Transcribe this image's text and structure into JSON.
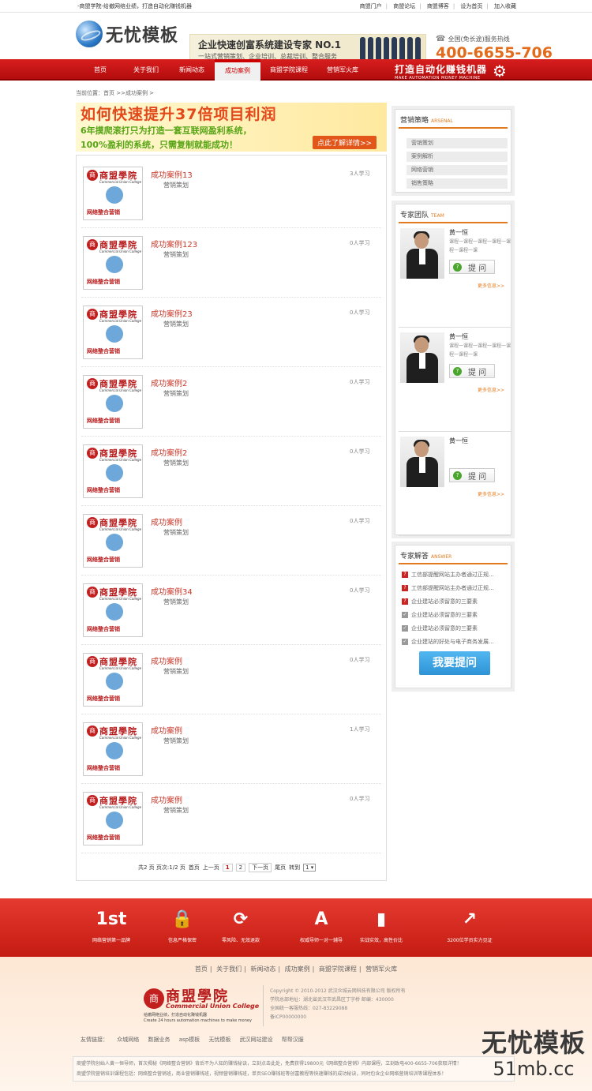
{
  "topbar": {
    "slogan": "-商盟学院-给撤网络业绩，打造自动化赚钱机器",
    "links": [
      "商盟门户",
      "商盟论坛",
      "商盟博客",
      "设为首页",
      "加入收藏"
    ]
  },
  "header": {
    "logo_text": "无忧模板",
    "banner_title": "企业快速创富系统建设专家 NO.1",
    "banner_sub": "一站式营销策划、企业培训、总裁培训、整合服务",
    "hotline_label": "全国(免长途)服务热线",
    "hotline_number": "400-6655-706"
  },
  "nav": {
    "items": [
      "首页",
      "关于我们",
      "新闻动态",
      "成功案例",
      "商盟学院课程",
      "营销军火库"
    ],
    "active_index": 3,
    "slogan": "打造自动化赚钱机器",
    "slogan_en": "MAKE AUTOMATION MONEY MACHINE"
  },
  "breadcrumb": "当前位置：首页 >>成功案例 >",
  "promo": {
    "line1": "如何快速提升37倍项目利润",
    "line2": "6年摸爬滚打只为打造一套互联网盈利系统，",
    "line3": "100%盈利的系统，只需复制就能成功！",
    "button": "点此了解详情>>"
  },
  "case_thumb": {
    "logo_char": "商",
    "title": "商盟學院",
    "en": "Commercial Union College",
    "bottom": "网络整合营销"
  },
  "cases": [
    {
      "title": "成功案例13",
      "sub": "营销策划",
      "count": "3人学习"
    },
    {
      "title": "成功案例123",
      "sub": "营销策划",
      "count": "0人学习"
    },
    {
      "title": "成功案例23",
      "sub": "营销策划",
      "count": "0人学习"
    },
    {
      "title": "成功案例2",
      "sub": "营销策划",
      "count": "0人学习"
    },
    {
      "title": "成功案例2",
      "sub": "营销策划",
      "count": "0人学习"
    },
    {
      "title": "成功案例",
      "sub": "营销策划",
      "count": "0人学习"
    },
    {
      "title": "成功案例34",
      "sub": "营销策划",
      "count": "0人学习"
    },
    {
      "title": "成功案例",
      "sub": "营销策划",
      "count": "0人学习"
    },
    {
      "title": "成功案例",
      "sub": "营销策划",
      "count": "1人学习"
    },
    {
      "title": "成功案例",
      "sub": "营销策划",
      "count": "0人学习"
    }
  ],
  "pager": {
    "summary": "共2 页 页次:1/2 页",
    "first": "首页",
    "prev": "上一页",
    "pages": [
      "1",
      "2"
    ],
    "next": "下一页",
    "last": "尾页",
    "goto": "转到",
    "select": "1"
  },
  "strategy": {
    "title": "营销策略",
    "en": "ARSENAL",
    "items": [
      "营销策划",
      "案例解析",
      "网络营销",
      "销售策略"
    ]
  },
  "team": {
    "title": "专家团队",
    "en": "TEAM",
    "experts": [
      {
        "name": "黄一恒",
        "desc": "课程一课程一课程一课程一课程一课程一课",
        "ask": "提 问",
        "more": "更多信息>>"
      },
      {
        "name": "黄一恒",
        "desc": "课程一课程一课程一课程一课程一课程一课",
        "ask": "提 问",
        "more": "更多信息>>"
      },
      {
        "name": "黄一恒",
        "desc": "",
        "ask": "提 问",
        "more": "更多信息>>"
      }
    ]
  },
  "answers": {
    "title": "专家解答",
    "en": "ANSWER",
    "items": [
      "工信部提醒网站主办者通过正规...",
      "工信部提醒网站主办者通过正规...",
      "企业建站必须留意的三要素",
      "企业建站必须留意的三要素",
      "企业建站必须留意的三要素",
      "企业建站的好处与电子商务发展..."
    ],
    "button": "我要提问"
  },
  "features": [
    {
      "icon": "1st",
      "label": "网络营销第一品牌"
    },
    {
      "icon": "🔒",
      "label": "信息严格保密"
    },
    {
      "icon": "⟳",
      "label": "零风险、无效退款"
    },
    {
      "icon": "A",
      "label": "权威导师一对一辅导"
    },
    {
      "icon": "▮",
      "label": "实战实效，高性价比"
    },
    {
      "icon": "↗",
      "label": "3200位学员实力见证"
    }
  ],
  "footer": {
    "nav": [
      "首页",
      "关于我们",
      "新闻动态",
      "成功案例",
      "商盟学院课程",
      "营销军火库"
    ],
    "logo_char": "商",
    "logo_title": "商盟學院",
    "logo_en": "Commercial Union College",
    "logo_sub1": "给撤网络业绩，打造自动化赚钱机器",
    "logo_sub2": "Create 24 hours automation machines to make money",
    "info": [
      "Copyright © 2010-2012  武汉众城云网科技有限公司  版权所有",
      "学院总部地址：湖北省武汉市武昌区丁字桥  邮编：430000",
      "全国统一客服热线：027-83229088",
      "备ICP00000000"
    ],
    "links_label": "友情链接：",
    "links": [
      "众城网络",
      "数据业务",
      "asp模板",
      "无忧模板",
      "武汉网站建设",
      "帮帮汉服"
    ],
    "note1": "商盟学院创始人黄一恒导师，首次揭秘《网络整合营销》背后不为人知的赚钱秘诀，立刻点击此处，免费获得19800元《网络整合营销》内部课程，立刻致电400-6655-706获取详情！",
    "note2": "商盟学院营销培训课程包括：网络整合营销班，商业营销赚钱班，视频营销赚钱班，单页SEO赚钱班等创富教程等快速赚钱的成功秘诀，同时包含企业网络营销培训等课程体系！"
  },
  "watermark": {
    "title": "无忧模板",
    "site": "51mb.cc"
  }
}
